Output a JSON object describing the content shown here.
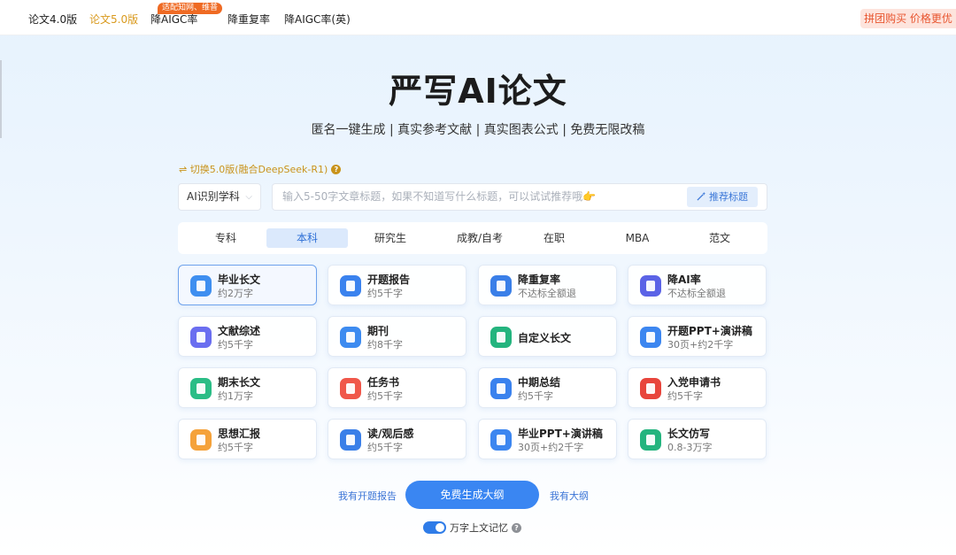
{
  "nav": {
    "items": [
      "论文4.0版",
      "论文5.0版",
      "降AIGC率",
      "降重复率",
      "降AIGC率(英)"
    ],
    "active_index": 1,
    "badge": "适配知网、维普",
    "promo": "拼团购买 价格更优"
  },
  "hero": {
    "title": "严写AI论文",
    "subtitle": "匿名一键生成 | 真实参考文献 | 真实图表公式 | 免费无限改稿"
  },
  "switch": {
    "label": "⇌ 切换5.0版(融合DeepSeek-R1)",
    "help": "?"
  },
  "form": {
    "subject_value": "AI识别学科",
    "subject_chevron": "⌵",
    "title_placeholder": "输入5-50字文章标题，如果不知道写什么标题，可以试试推荐哦👉",
    "recommend_label": "推荐标题"
  },
  "levels": {
    "items": [
      "专科",
      "本科",
      "研究生",
      "成教/自考",
      "在职",
      "MBA",
      "范文"
    ],
    "active_index": 1
  },
  "cards": [
    {
      "title": "毕业长文",
      "desc": "约2万字",
      "color": "#3f8ff0",
      "icon": "book-icon"
    },
    {
      "title": "开题报告",
      "desc": "约5千字",
      "color": "#3a82ee",
      "icon": "report-icon"
    },
    {
      "title": "降重复率",
      "desc": "不达标全额退",
      "color": "#3a7fe8",
      "icon": "monitor-icon"
    },
    {
      "title": "降AI率",
      "desc": "不达标全额退",
      "color": "#5b63e6",
      "icon": "ai-icon"
    },
    {
      "title": "文献综述",
      "desc": "约5千字",
      "color": "#6a6ef0",
      "icon": "document-icon"
    },
    {
      "title": "期刊",
      "desc": "约8千字",
      "color": "#3d8bf0",
      "icon": "journal-icon"
    },
    {
      "title": "自定义长文",
      "desc": "",
      "color": "#24b47e",
      "icon": "pen-icon"
    },
    {
      "title": "开题PPT+演讲稿",
      "desc": "30页+约2千字",
      "color": "#3c86f0",
      "icon": "ppt-icon"
    },
    {
      "title": "期末长文",
      "desc": "约1万字",
      "color": "#2bbd86",
      "icon": "notes-icon"
    },
    {
      "title": "任务书",
      "desc": "约5千字",
      "color": "#f0574a",
      "icon": "task-icon"
    },
    {
      "title": "中期总结",
      "desc": "约5千字",
      "color": "#3a82ee",
      "icon": "summary-icon"
    },
    {
      "title": "入党申请书",
      "desc": "约5千字",
      "color": "#e8453c",
      "icon": "party-icon"
    },
    {
      "title": "思想汇报",
      "desc": "约5千字",
      "color": "#f5a23a",
      "icon": "thought-icon"
    },
    {
      "title": "读/观后感",
      "desc": "约5千字",
      "color": "#3a7fe8",
      "icon": "reading-icon"
    },
    {
      "title": "毕业PPT+演讲稿",
      "desc": "30页+约2千字",
      "color": "#3c86f0",
      "icon": "ppt-icon"
    },
    {
      "title": "长文仿写",
      "desc": "0.8-3万字",
      "color": "#24b47e",
      "icon": "imitate-icon"
    }
  ],
  "selected_card": 0,
  "actions": {
    "left_link": "我有开题报告",
    "main_button": "免费生成大纲",
    "right_link": "我有大纲"
  },
  "memory": {
    "label": "万字上文记忆",
    "enabled": true,
    "help": "?"
  }
}
